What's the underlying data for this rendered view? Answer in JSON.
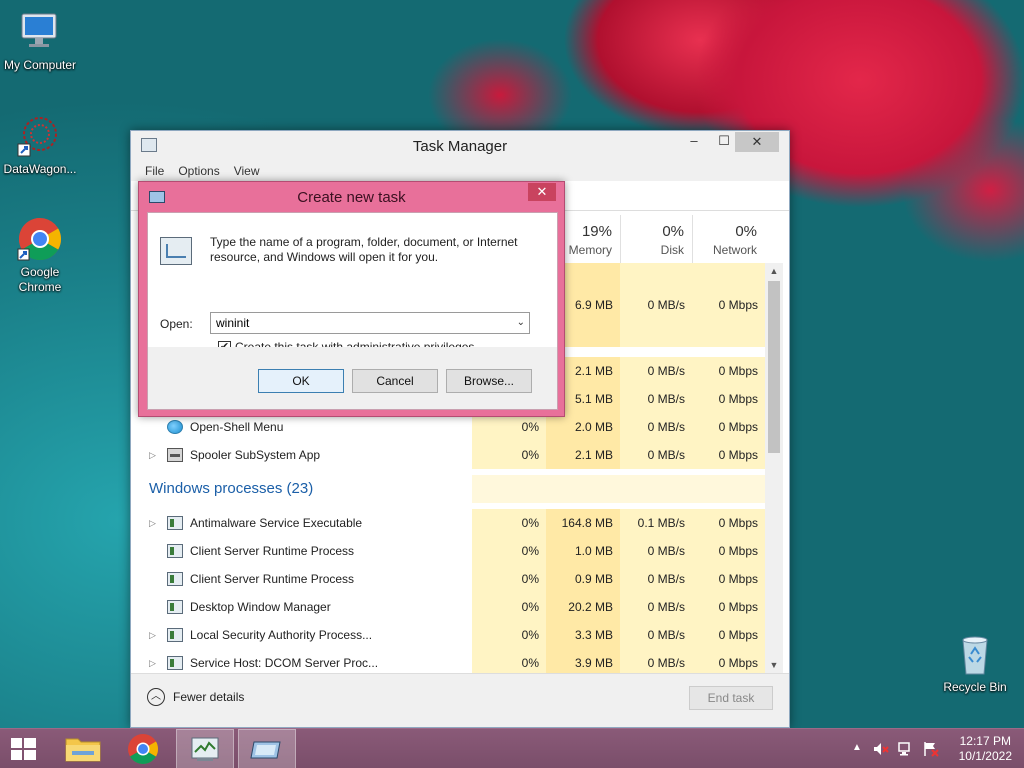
{
  "desktop": {
    "icons": [
      {
        "label": "My Computer",
        "icon": "computer-icon"
      },
      {
        "label": "DataWagon...",
        "icon": "shortcut-icon"
      },
      {
        "label": "Google Chrome",
        "icon": "chrome-icon"
      },
      {
        "label": "Recycle Bin",
        "icon": "recycle-bin-icon"
      }
    ]
  },
  "task_manager": {
    "title": "Task Manager",
    "menu": [
      "File",
      "Options",
      "View"
    ],
    "controls": {
      "minimize": "–",
      "maximize": "☐",
      "close": "✕"
    },
    "columns": [
      {
        "pct": "19%",
        "label": "Memory"
      },
      {
        "pct": "0%",
        "label": "Disk"
      },
      {
        "pct": "0%",
        "label": "Network"
      }
    ],
    "hidden_rows": [
      {
        "mem": "6.9 MB",
        "disk": "0 MB/s",
        "net": "0 Mbps"
      },
      {
        "mem": "2.1 MB",
        "disk": "0 MB/s",
        "net": "0 Mbps"
      },
      {
        "mem": "5.1 MB",
        "disk": "0 MB/s",
        "net": "0 Mbps"
      }
    ],
    "app_rows": [
      {
        "name": "Open-Shell Menu",
        "cpu": "0%",
        "mem": "2.0 MB",
        "disk": "0 MB/s",
        "net": "0 Mbps",
        "expand": ""
      },
      {
        "name": "Spooler SubSystem App",
        "cpu": "0%",
        "mem": "2.1 MB",
        "disk": "0 MB/s",
        "net": "0 Mbps",
        "expand": "▷"
      }
    ],
    "windows_group": "Windows processes (23)",
    "win_rows": [
      {
        "name": "Antimalware Service Executable",
        "cpu": "0%",
        "mem": "164.8 MB",
        "disk": "0.1 MB/s",
        "net": "0 Mbps",
        "expand": "▷"
      },
      {
        "name": "Client Server Runtime Process",
        "cpu": "0%",
        "mem": "1.0 MB",
        "disk": "0 MB/s",
        "net": "0 Mbps",
        "expand": ""
      },
      {
        "name": "Client Server Runtime Process",
        "cpu": "0%",
        "mem": "0.9 MB",
        "disk": "0 MB/s",
        "net": "0 Mbps",
        "expand": ""
      },
      {
        "name": "Desktop Window Manager",
        "cpu": "0%",
        "mem": "20.2 MB",
        "disk": "0 MB/s",
        "net": "0 Mbps",
        "expand": ""
      },
      {
        "name": "Local Security Authority Process...",
        "cpu": "0%",
        "mem": "3.3 MB",
        "disk": "0 MB/s",
        "net": "0 Mbps",
        "expand": "▷"
      },
      {
        "name": "Service Host: DCOM Server Proc...",
        "cpu": "0%",
        "mem": "3.9 MB",
        "disk": "0 MB/s",
        "net": "0 Mbps",
        "expand": "▷"
      }
    ],
    "footer": {
      "fewer_details": "Fewer details",
      "end_task": "End task"
    }
  },
  "dialog": {
    "title": "Create new task",
    "close": "✕",
    "description": "Type the name of a program, folder, document, or Internet resource, and Windows will open it for you.",
    "open_label": "Open:",
    "open_value": "wininit",
    "admin_checkbox": {
      "label": "Create this task with administrative privileges.",
      "checked": true
    },
    "buttons": {
      "ok": "OK",
      "cancel": "Cancel",
      "browse": "Browse..."
    }
  },
  "taskbar": {
    "clock_time": "12:17 PM",
    "clock_date": "10/1/2022",
    "tray_chevron": "▲"
  }
}
